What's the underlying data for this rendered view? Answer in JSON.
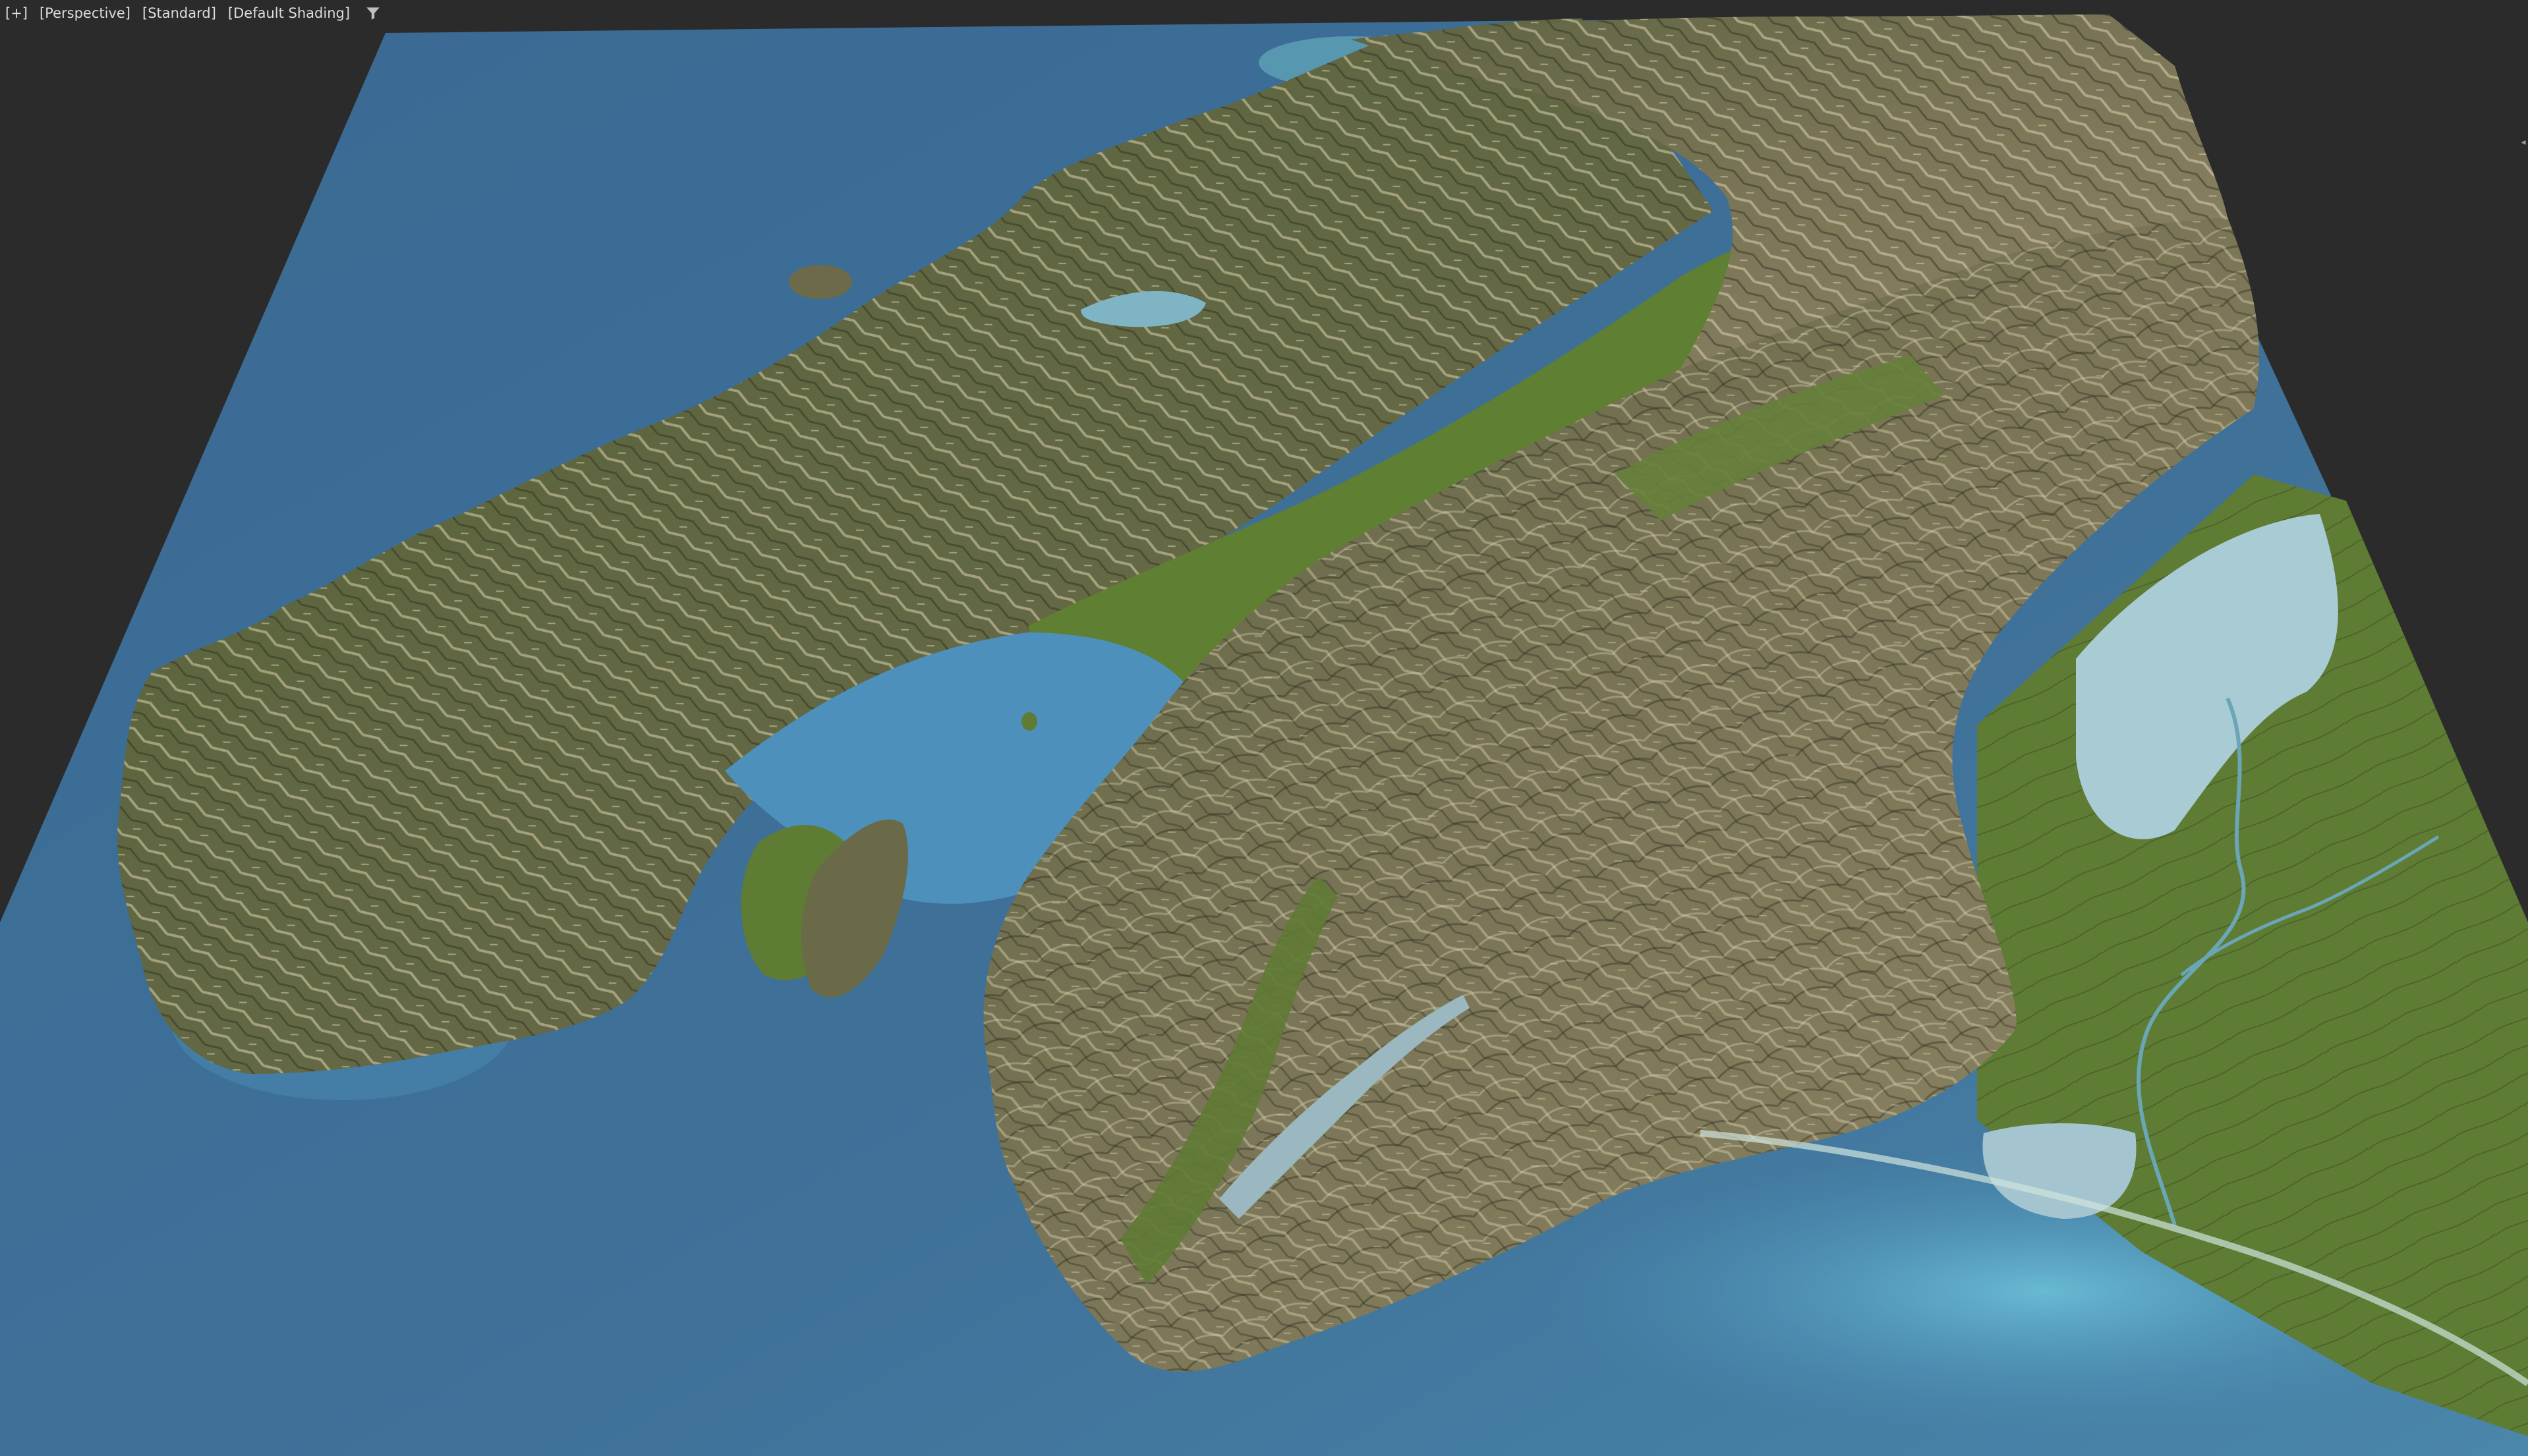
{
  "viewport": {
    "menus": [
      {
        "id": "viewport-general-menu",
        "label": "[+]"
      },
      {
        "id": "viewport-pov-menu",
        "label": "[Perspective]"
      },
      {
        "id": "viewport-standard-menu",
        "label": "[Standard]"
      },
      {
        "id": "viewport-shading-menu",
        "label": "[Default Shading]"
      }
    ],
    "filter_icon": "filter-funnel-icon",
    "right_marker": "◂"
  },
  "colors": {
    "background": "#2b2b2b",
    "ocean_deep": "#3f6f95",
    "ocean_shallow": "#5aa8c8",
    "land_lowland": "#5e7a35",
    "land_mountain": "#6f6a4e",
    "ridge_light": "#cfc6a3",
    "lake": "#9cc3cf"
  }
}
